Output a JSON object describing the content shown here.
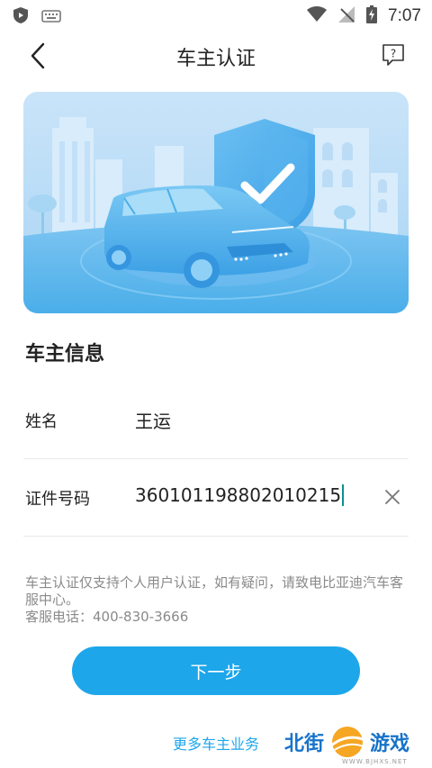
{
  "status_bar": {
    "time": "7:07",
    "icons": [
      "shield-status-icon",
      "keyboard-status-icon",
      "wifi-icon",
      "no-signal-icon",
      "battery-charging-icon"
    ]
  },
  "nav": {
    "title": "车主认证",
    "back_icon": "chevron-left-icon",
    "help_icon": "help-question-icon"
  },
  "section": {
    "title": "车主信息"
  },
  "form": {
    "name_label": "姓名",
    "name_value": "王运",
    "id_label": "证件号码",
    "id_value": "360101198802010215"
  },
  "notice": {
    "line1": "车主认证仅支持个人用户认证，如有疑问，请致电比亚迪汽车客服中心。",
    "line2": "客服电话：400-830-3666"
  },
  "actions": {
    "next_label": "下一步",
    "more_link": "更多车主业务"
  },
  "watermark": {
    "left": "北街",
    "right": "游戏",
    "site": "WWW.BJHXS.NET"
  },
  "colors": {
    "primary": "#1ea6ea",
    "banner_bg": "#bcdcf6",
    "car": "#56b6ee",
    "text": "#222222",
    "muted": "#8a8a8a"
  }
}
